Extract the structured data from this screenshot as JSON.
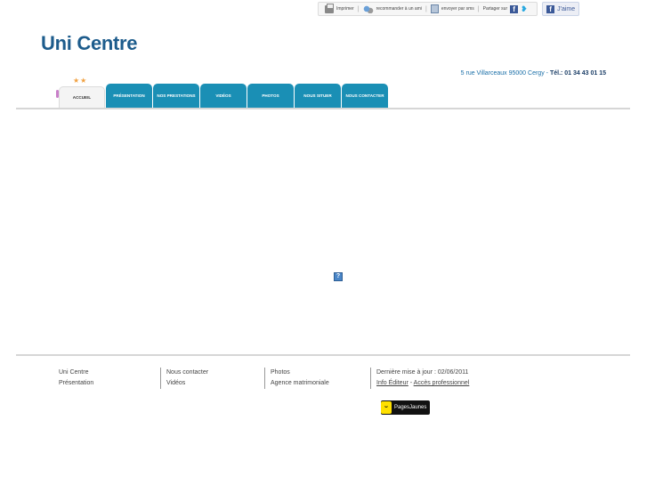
{
  "toolbar": {
    "print_label": "Imprimer",
    "recommend_label": "recommander à un ami",
    "send_label": "envoyer par sms",
    "share_label": "Partager sur",
    "like_label": "J'aime"
  },
  "header": {
    "site_title": "Uni Centre",
    "address": "5 rue Villarceaux 95000 Cergy",
    "address_sep": "-",
    "tel": "Tél.: 01 34 43 01 15"
  },
  "nav": {
    "stars": "★★",
    "tabs": [
      {
        "label": "ACCUEIL"
      },
      {
        "label": "PRÉSENTATION"
      },
      {
        "label": "NOS PRESTATIONS"
      },
      {
        "label": "VIDÉOS"
      },
      {
        "label": "PHOTOS"
      },
      {
        "label": "NOUS SITUER"
      },
      {
        "label": "NOUS CONTACTER"
      }
    ]
  },
  "main": {
    "placeholder_icon": "?"
  },
  "footer": {
    "col1": [
      "Uni Centre",
      "Présentation"
    ],
    "col2": [
      "Nous contacter",
      "Vidéos"
    ],
    "col3": [
      "Photos",
      "Agence matrimoniale"
    ],
    "last_update": "Dernière mise à jour : 02/06/2011",
    "info_editeur": "Info Éditeur",
    "link_sep": " - ",
    "acces_pro": "Accès professionnel",
    "pj_face": "ᵕ",
    "pj_label": "PagesJaunes"
  },
  "colors": {
    "brand": "#1d5c8c",
    "tab": "#1a8fb5"
  }
}
